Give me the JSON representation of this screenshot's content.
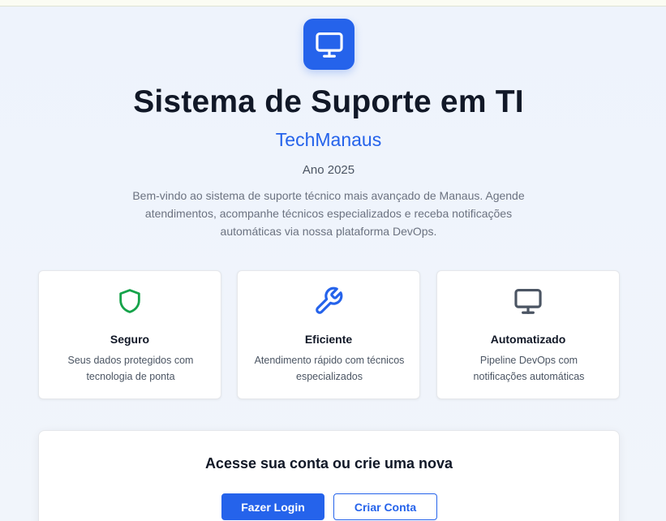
{
  "header": {
    "title": "Sistema de Suporte em TI",
    "brand": "TechManaus",
    "year": "Ano 2025",
    "description": "Bem-vindo ao sistema de suporte técnico mais avançado de Manaus. Agende atendimentos, acompanhe técnicos especializados e receba notificações automáticas via nossa plataforma DevOps.",
    "icon": "monitor-icon"
  },
  "features": [
    {
      "icon": "shield-icon",
      "title": "Seguro",
      "text": "Seus dados protegidos com tecnologia de ponta",
      "color": "#16a34a"
    },
    {
      "icon": "wrench-icon",
      "title": "Eficiente",
      "text": "Atendimento rápido com técnicos especializados",
      "color": "#2563eb"
    },
    {
      "icon": "monitor-icon",
      "title": "Automatizado",
      "text": "Pipeline DevOps com notificações automáticas",
      "color": "#4b5563"
    }
  ],
  "auth": {
    "title": "Acesse sua conta ou crie uma nova",
    "login_label": "Fazer Login",
    "signup_label": "Criar Conta"
  },
  "colors": {
    "primary": "#2563eb",
    "success": "#16a34a",
    "text": "#111827",
    "muted": "#6b7280"
  }
}
